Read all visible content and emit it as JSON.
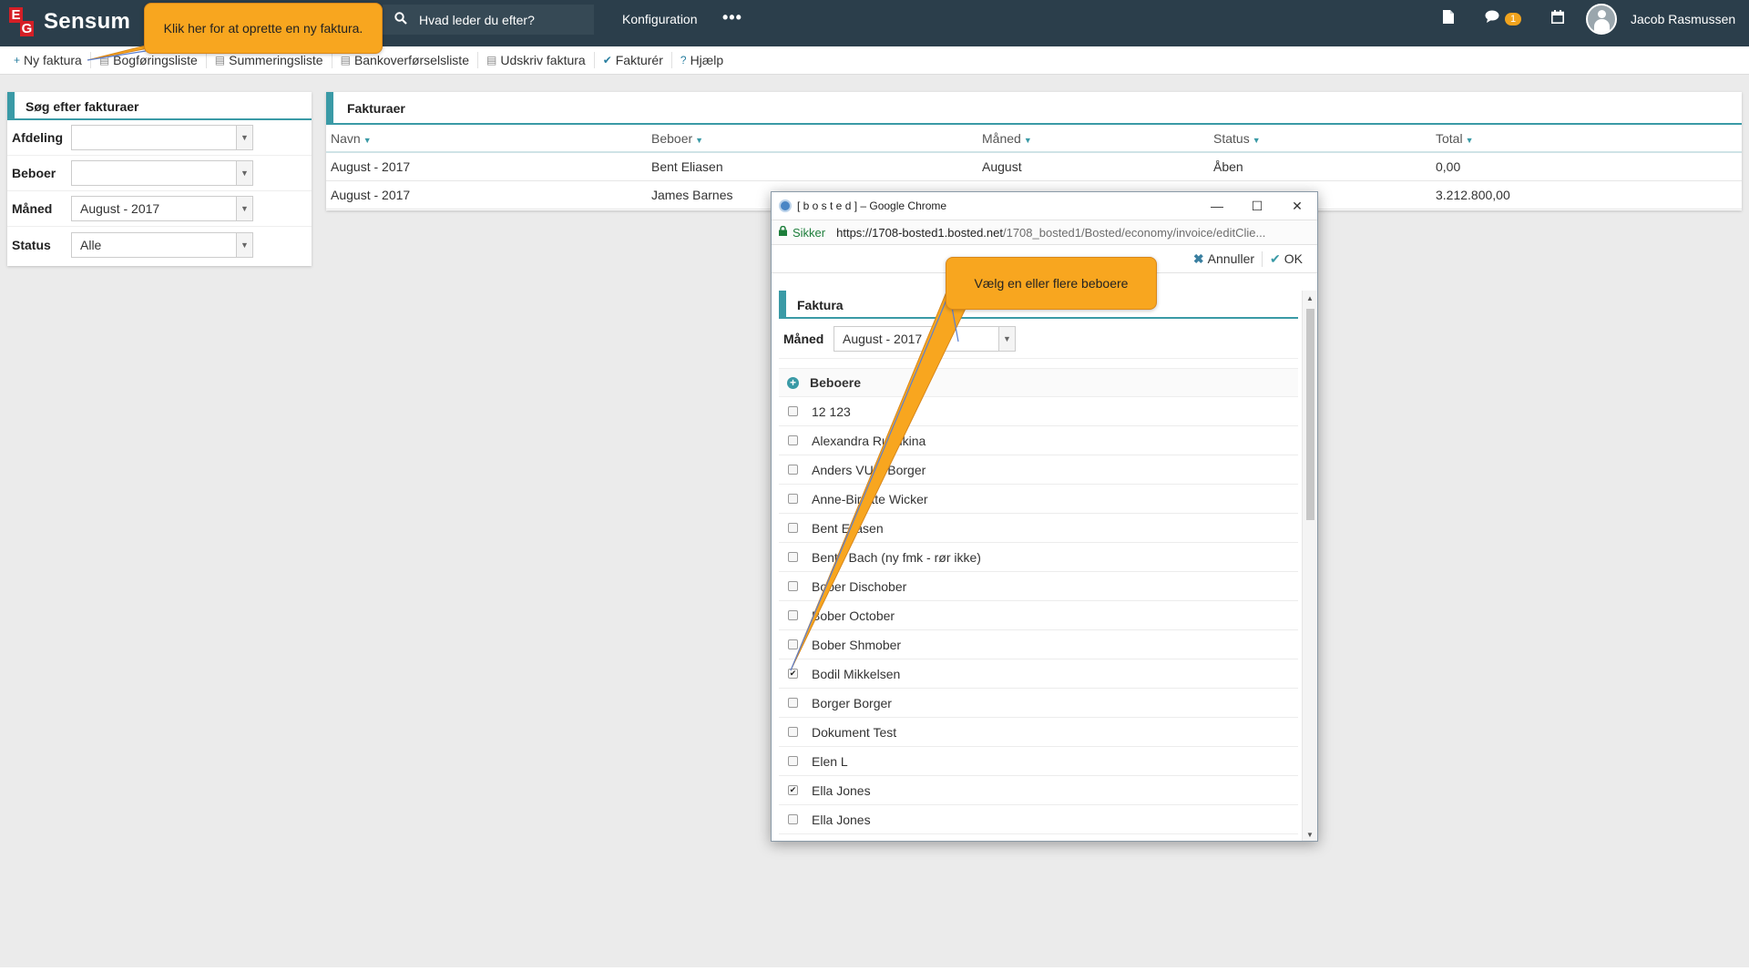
{
  "app": {
    "logo_mark_e": "E",
    "logo_mark_g": "G",
    "logo_text": "Sensum"
  },
  "topbar": {
    "search_placeholder": "Hvad leder du efter?",
    "config_label": "Konfiguration",
    "more_label": "•••",
    "messages_badge": "1",
    "username": "Jacob Rasmussen"
  },
  "toolbar": {
    "items": [
      {
        "icon": "+",
        "label": "Ny faktura"
      },
      {
        "icon": "▤",
        "label": "Bogføringsliste"
      },
      {
        "icon": "▤",
        "label": "Summeringsliste"
      },
      {
        "icon": "▤",
        "label": "Bankoverførselsliste"
      },
      {
        "icon": "▤",
        "label": "Udskriv faktura"
      },
      {
        "icon": "✔",
        "label": "Fakturér"
      },
      {
        "icon": "?",
        "label": "Hjælp"
      }
    ]
  },
  "search_panel": {
    "title": "Søg efter fakturaer",
    "fields": [
      {
        "label": "Afdeling",
        "value": ""
      },
      {
        "label": "Beboer",
        "value": ""
      },
      {
        "label": "Måned",
        "value": "August - 2017"
      },
      {
        "label": "Status",
        "value": "Alle"
      }
    ]
  },
  "invoices": {
    "title": "Fakturaer",
    "columns": [
      "Navn",
      "Beboer",
      "Måned",
      "Status",
      "Total"
    ],
    "rows": [
      [
        "August - 2017",
        "Bent Eliasen",
        "August",
        "Åben",
        "0,00"
      ],
      [
        "August - 2017",
        "James Barnes",
        "",
        "",
        "3.212.800,00"
      ]
    ]
  },
  "popup": {
    "window_title": "[ b o s t e d ] – Google Chrome",
    "secure_label": "Sikker",
    "url_host": "https://1708-bosted1.bosted.net",
    "url_path": "/1708_bosted1/Bosted/economy/invoice/editClie...",
    "cancel_label": "Annuller",
    "ok_label": "OK",
    "section_title": "Faktura",
    "month_label": "Måned",
    "month_value": "August - 2017",
    "residents_header": "Beboere",
    "residents": [
      {
        "name": "12 123",
        "checked": false
      },
      {
        "name": "Alexandra Rushkina",
        "checked": false
      },
      {
        "name": "Anders VUM Borger",
        "checked": false
      },
      {
        "name": "Anne-Birgitte Wicker",
        "checked": false
      },
      {
        "name": "Bent Eliasen",
        "checked": false
      },
      {
        "name": "Bente Bach (ny fmk - rør ikke)",
        "checked": false
      },
      {
        "name": "Bober Dischober",
        "checked": false
      },
      {
        "name": "Bober October",
        "checked": false
      },
      {
        "name": "Bober Shmober",
        "checked": false
      },
      {
        "name": "Bodil Mikkelsen",
        "checked": true
      },
      {
        "name": "Borger Borger",
        "checked": false
      },
      {
        "name": "Dokument Test",
        "checked": false
      },
      {
        "name": "Elen L",
        "checked": false
      },
      {
        "name": "Ella Jones",
        "checked": true
      },
      {
        "name": "Ella Jones",
        "checked": false
      }
    ]
  },
  "tooltips": {
    "new_invoice": "Klik her for at oprette en ny faktura.",
    "select_residents": "Vælg en eller flere beboere"
  },
  "colors": {
    "topbar": "#2b3e4b",
    "accent": "#3a9aa6",
    "tooltip": "#f8a61f"
  },
  "icons": {
    "search": "search-icon",
    "document": "document-icon",
    "chat": "chat-icon",
    "calendar": "calendar-icon",
    "avatar": "user-avatar-icon"
  }
}
